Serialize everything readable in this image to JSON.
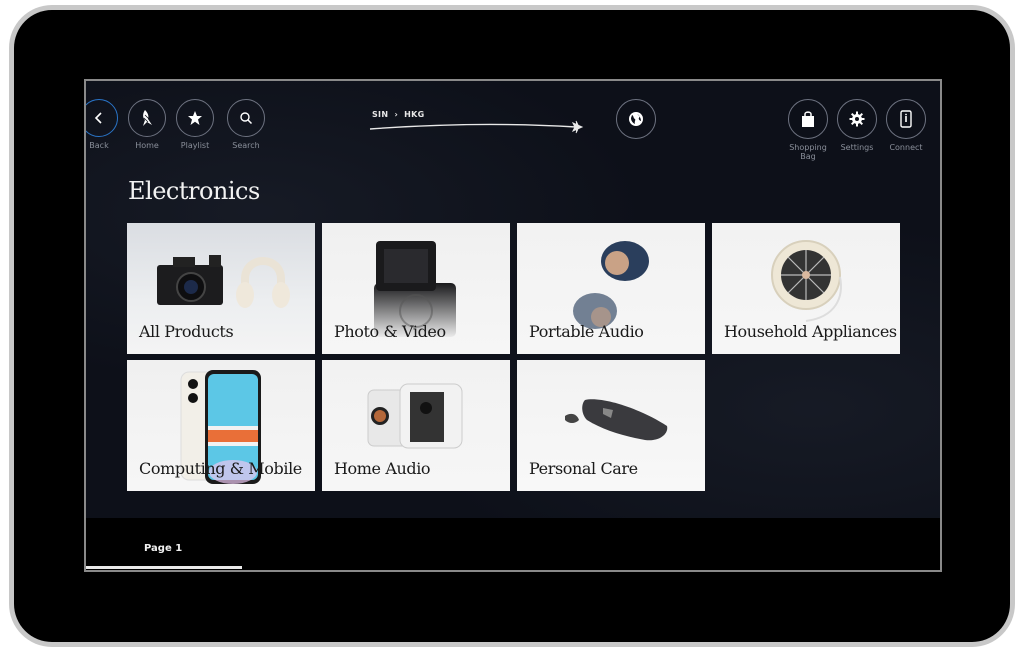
{
  "nav": {
    "left": [
      {
        "label": "Back",
        "icon": "chevron-left-icon"
      },
      {
        "label": "Home",
        "icon": "bird-logo-icon"
      },
      {
        "label": "Playlist",
        "icon": "star-icon"
      },
      {
        "label": "Search",
        "icon": "search-icon"
      }
    ],
    "right": [
      {
        "label": "Shopping Bag",
        "icon": "shopping-bag-icon"
      },
      {
        "label": "Settings",
        "icon": "gear-icon"
      },
      {
        "label": "Connect",
        "icon": "phone-icon"
      }
    ]
  },
  "route": {
    "origin": "SIN",
    "separator": "›",
    "destination": "HKG"
  },
  "page_title": "Electronics",
  "categories": [
    {
      "label": "All Products"
    },
    {
      "label": "Photo & Video"
    },
    {
      "label": "Portable Audio"
    },
    {
      "label": "Household Appliances"
    },
    {
      "label": "Computing & Mobile"
    },
    {
      "label": "Home Audio"
    },
    {
      "label": "Personal Care"
    }
  ],
  "pagination": {
    "current_label": "Page 1"
  },
  "colors": {
    "accent": "#2a74c7",
    "background": "#0d1019"
  }
}
